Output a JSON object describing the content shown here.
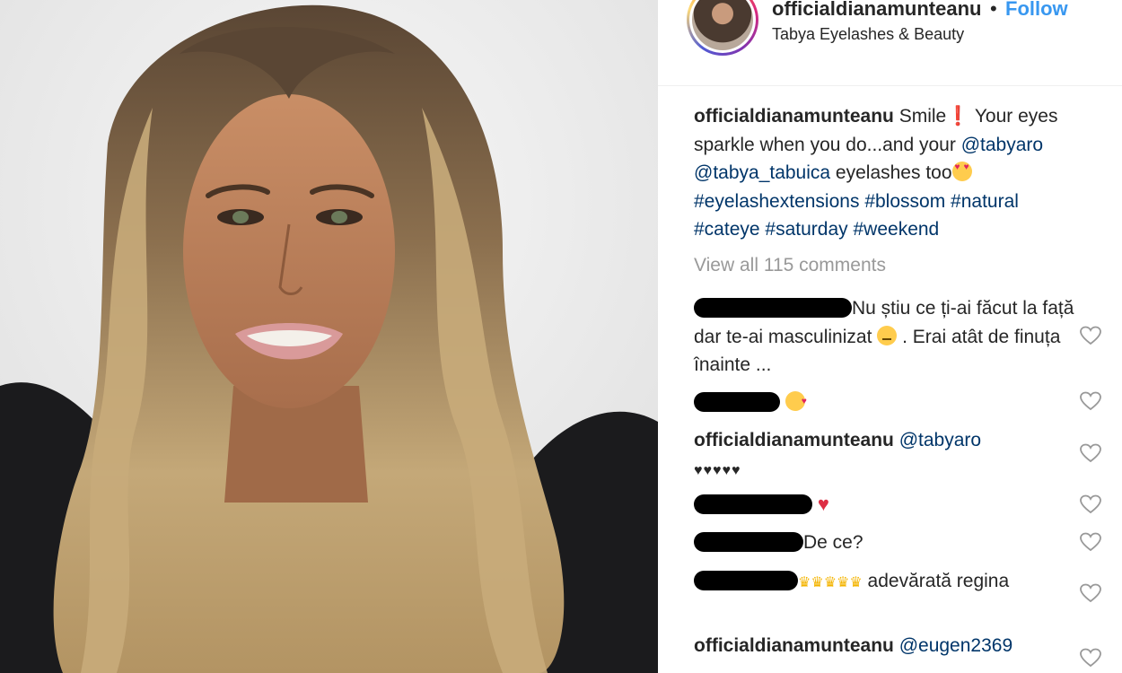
{
  "header": {
    "username": "officialdianamunteanu",
    "dot": "•",
    "follow_label": "Follow",
    "location": "Tabya Eyelashes & Beauty"
  },
  "caption": {
    "username": "officialdianamunteanu",
    "text_1": " Smile",
    "text_2": " Your eyes sparkle when you do...and your ",
    "mention_1": "@tabyaro",
    "mention_2": "@tabya_tabuica",
    "text_3": " eyelashes too",
    "hashtags": [
      "#eyelashextensions",
      "#blossom",
      "#natural",
      "#cateye",
      "#saturday",
      "#weekend"
    ]
  },
  "view_all_comments": "View all 115 comments",
  "comments": [
    {
      "text": "Nu știu ce ți-ai făcut la față dar te-ai masculinizat",
      "text_after": " . Erai atât de finuța înainte ..."
    },
    {
      "text": ""
    },
    {
      "username": "officialdianamunteanu",
      "mention": "@tabyaro",
      "text": "♥♥♥♥♥"
    },
    {
      "text": ""
    },
    {
      "text": "De ce?"
    },
    {
      "text": " adevărată regina"
    },
    {
      "username": "officialdianamunteanu",
      "mention": "@eugen2369"
    }
  ],
  "colors": {
    "link": "#003569",
    "follow": "#3897f0",
    "muted": "#999999",
    "text": "#262626"
  },
  "icons": {
    "like": "heart-outline-icon",
    "exclamation": "red-exclamation-icon",
    "heart_eyes": "heart-eyes-emoji-icon",
    "kiss": "kissing-heart-emoji-icon",
    "expressionless": "expressionless-emoji-icon",
    "red_heart": "red-heart-emoji-icon",
    "crowns": "crown-emoji-icon"
  }
}
